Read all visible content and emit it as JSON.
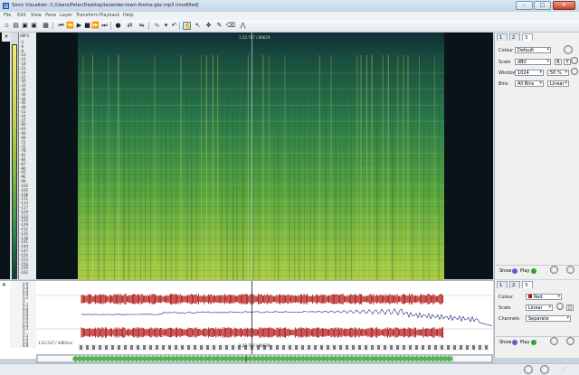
{
  "window": {
    "title": "Sonic Visualiser: C:/Users/Peter/Desktop/lavender-town-theme-gbc.mp3 (modified)"
  },
  "menu": [
    "File",
    "Edit",
    "View",
    "Pane",
    "Layer",
    "Transform",
    "Playback",
    "Help"
  ],
  "toolbar": {
    "icons": [
      "new-file-icon",
      "open-file-icon",
      "save-icon",
      "save-as-icon",
      "rewind-start-icon",
      "rewind-icon",
      "play-icon",
      "stop-icon",
      "forward-icon",
      "forward-end-icon",
      "record-icon",
      "loop-icon",
      "selection-loop-icon",
      "speed-icon",
      "navigate-tool-icon",
      "select-tool-icon",
      "move-tool-icon",
      "draw-tool-icon",
      "erase-tool-icon",
      "measure-tool-icon"
    ]
  },
  "spectrogram": {
    "db_scale_label": "dBFS",
    "db_ticks": [
      "-3",
      "-6",
      "-9",
      "-12",
      "-15",
      "-18",
      "-21",
      "-24",
      "-27",
      "-30",
      "-33",
      "-36",
      "-39",
      "-42",
      "-45",
      "-48",
      "-51",
      "-54",
      "-57",
      "-60",
      "-63",
      "-66",
      "-69",
      "-72",
      "-75",
      "-78",
      "-81",
      "-84",
      "-87",
      "-90",
      "-93",
      "-96",
      "-99",
      "-102",
      "-105",
      "-108",
      "-111",
      "-114",
      "-117",
      "-120",
      "-123",
      "-126",
      "-129",
      "-132",
      "-135",
      "-138",
      "-141",
      "-144",
      "-147",
      "-150",
      "-153",
      "-156",
      "-159",
      "-162"
    ],
    "playhead_label": "1:22.787 / 86629",
    "colors": {
      "low": "#0f3b33",
      "mid": "#7fba3b",
      "high": "#f5f06a"
    }
  },
  "props_spectrogram": {
    "tabs": [
      "1",
      "2",
      "3"
    ],
    "rows": [
      {
        "label": "Colour",
        "value": "Default"
      },
      {
        "label": "Scale",
        "value": "dBV"
      },
      {
        "label": "Window",
        "value": "1024",
        "extra": "50 %"
      },
      {
        "label": "Bins",
        "value": "All Bins",
        "extra": "Linear"
      }
    ],
    "scale_buttons": [
      "R",
      "Y"
    ],
    "show_label": "Show",
    "play_label": "Play"
  },
  "waveform": {
    "ticks": [
      "0.9",
      "0.8",
      "0.6",
      "0.4",
      "0.2",
      "0",
      "0.2",
      "0.4",
      "0.6",
      "0.8",
      "0.9",
      "0.6",
      "0.4",
      "0.2",
      "0",
      "0.2",
      "0.4",
      "0.6",
      "0.8"
    ],
    "time_left": "1:22.537 / 4465ms",
    "time_mid": "1:22.787 / 86629",
    "colors": {
      "wave": "#b01010",
      "line": "#1a237e",
      "overview": "#28a028"
    }
  },
  "props_waveform": {
    "tabs": [
      "1",
      "2",
      "3"
    ],
    "rows": [
      {
        "label": "Colour",
        "value": "Red"
      },
      {
        "label": "Scale",
        "value": "Linear"
      },
      {
        "label": "Channels",
        "value": "Separate"
      }
    ],
    "show_label": "Show",
    "play_label": "Play"
  }
}
